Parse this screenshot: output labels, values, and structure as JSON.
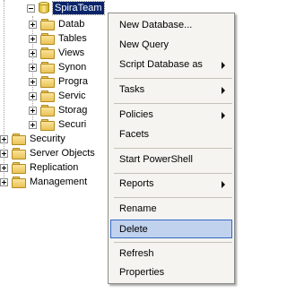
{
  "tree": {
    "database": "SpiraTeam",
    "children": [
      "Datab",
      "Tables",
      "Views",
      "Synon",
      "Progra",
      "Servic",
      "Storag",
      "Securi"
    ],
    "root_items": [
      "Security",
      "Server Objects",
      "Replication",
      "Management"
    ]
  },
  "menu": {
    "items": [
      {
        "label": "New Database...",
        "submenu": false
      },
      {
        "label": "New Query",
        "submenu": false
      },
      {
        "label": "Script Database as",
        "submenu": true
      },
      {
        "label": "Tasks",
        "submenu": true
      },
      {
        "label": "Policies",
        "submenu": true
      },
      {
        "label": "Facets",
        "submenu": false
      },
      {
        "label": "Start PowerShell",
        "submenu": false
      },
      {
        "label": "Reports",
        "submenu": true
      },
      {
        "label": "Rename",
        "submenu": false
      },
      {
        "label": "Delete",
        "submenu": false,
        "highlighted": true
      },
      {
        "label": "Refresh",
        "submenu": false
      },
      {
        "label": "Properties",
        "submenu": false
      }
    ]
  },
  "colors": {
    "selection_bg": "#0a246a",
    "menu_highlight_bg": "#c1d2ee",
    "menu_highlight_border": "#316ac5",
    "menu_bg": "#f5f4f0"
  }
}
